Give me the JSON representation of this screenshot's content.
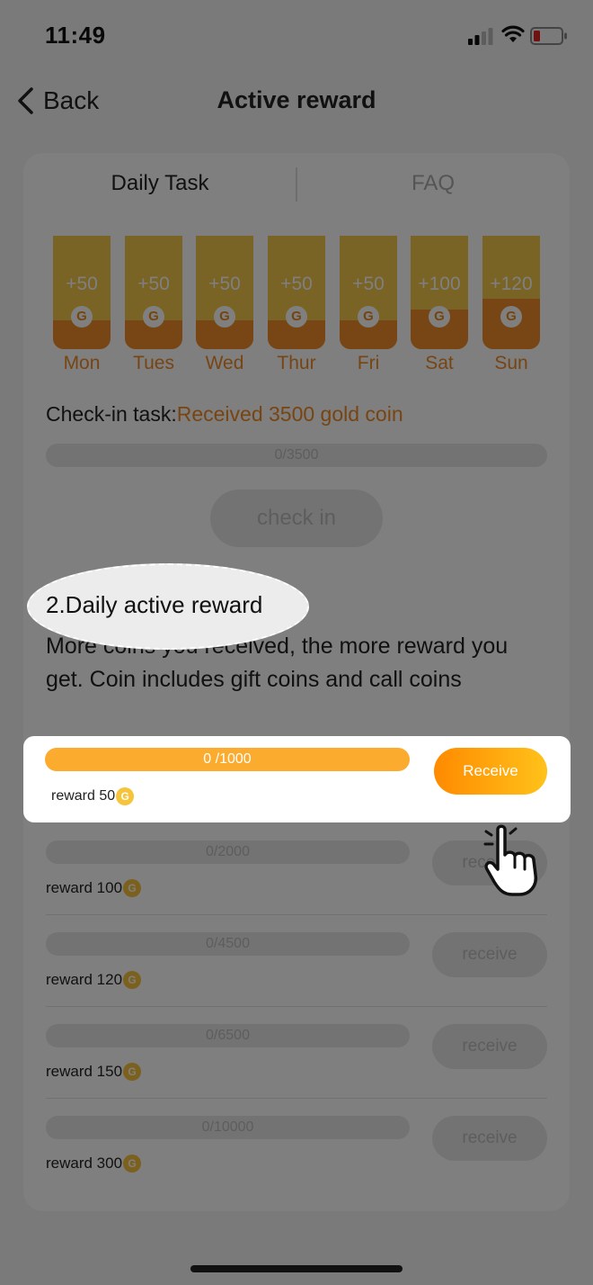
{
  "status_bar": {
    "time": "11:49"
  },
  "nav": {
    "back_label": "Back",
    "title": "Active reward"
  },
  "tabs": [
    {
      "label": "Daily Task"
    },
    {
      "label": "FAQ"
    }
  ],
  "days": [
    {
      "label": "Mon",
      "amount": "+50",
      "coin": "G"
    },
    {
      "label": "Tues",
      "amount": "+50",
      "coin": "G"
    },
    {
      "label": "Wed",
      "amount": "+50",
      "coin": "G"
    },
    {
      "label": "Thur",
      "amount": "+50",
      "coin": "G"
    },
    {
      "label": "Fri",
      "amount": "+50",
      "coin": "G"
    },
    {
      "label": "Sat",
      "amount": "+100",
      "coin": "G"
    },
    {
      "label": "Sun",
      "amount": "+120",
      "coin": "G"
    }
  ],
  "checkin": {
    "task_label": "Check-in task:",
    "task_value": "Received 3500 gold coin",
    "progress_text": "0/3500",
    "button_label": "check in"
  },
  "section": {
    "heading": "2.Daily active reward",
    "description": "More coins you received, the more reward you get. Coin includes gift coins and call coins"
  },
  "reward_rows": [
    {
      "progress_text": "0 /1000",
      "reward_label": "reward 50",
      "button_label": "Receive"
    },
    {
      "progress_text": "0/2000",
      "reward_label": "reward 100",
      "button_label": "receive"
    },
    {
      "progress_text": "0/4500",
      "reward_label": "reward 120",
      "button_label": "receive"
    },
    {
      "progress_text": "0/6500",
      "reward_label": "reward 150",
      "button_label": "receive"
    },
    {
      "progress_text": "0/10000",
      "reward_label": "reward 300",
      "button_label": "receive"
    }
  ],
  "coin_glyph": "G",
  "colors": {
    "accent_orange": "#ef8a26",
    "gold": "#f5c84a",
    "progress_active": "#fbab2e",
    "receive_gradient_start": "#ff8a00",
    "receive_gradient_end": "#ffc21a"
  },
  "icons": {
    "back": "chevron-left-icon",
    "signal": "cellular-signal-icon",
    "wifi": "wifi-icon",
    "battery": "battery-low-icon",
    "coin": "gold-coin-icon",
    "hand": "pointing-hand-icon"
  }
}
